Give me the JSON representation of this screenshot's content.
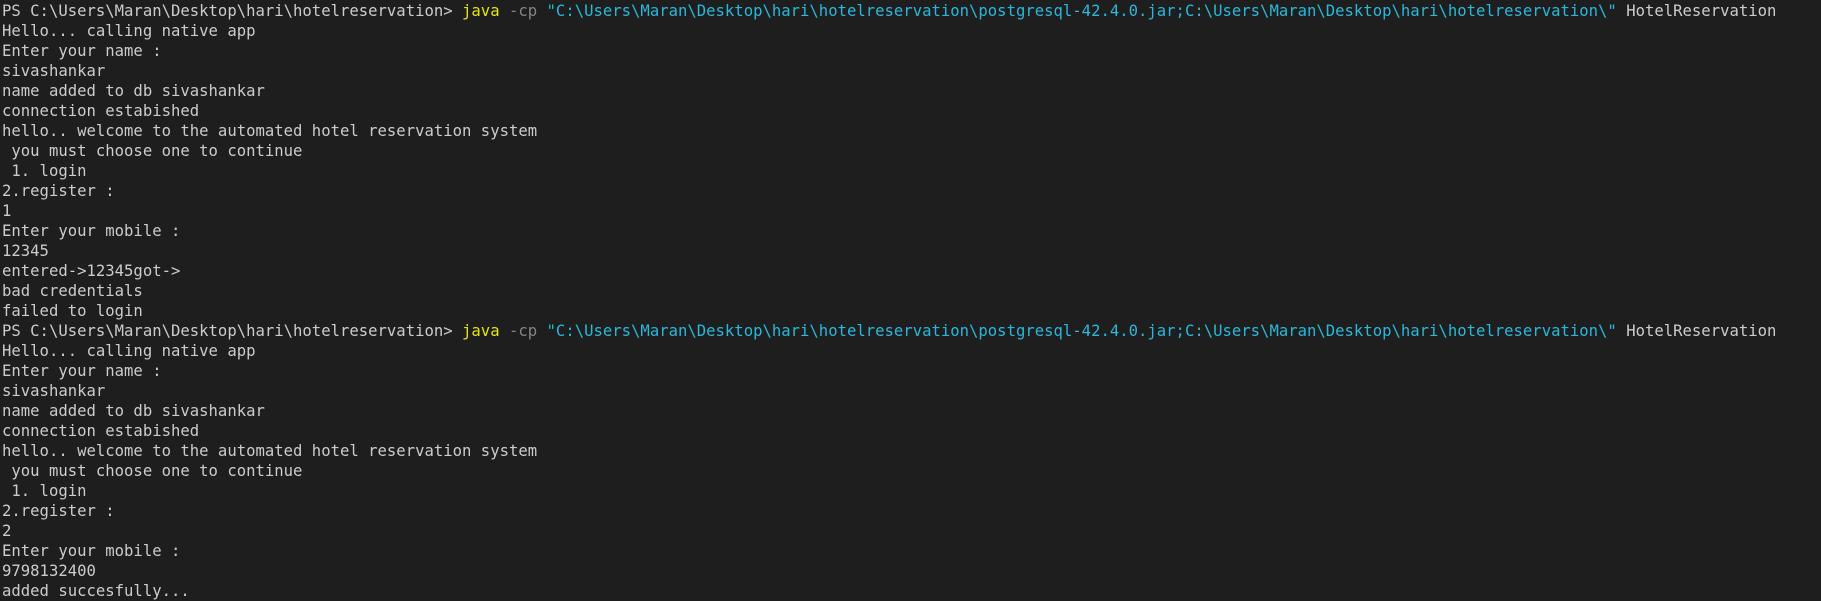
{
  "colors": {
    "background": "#1e1e1e",
    "foreground": "#cccccc",
    "command": "#e5e510",
    "parameter": "#858585",
    "string": "#29b8db"
  },
  "session": [
    {
      "prompt": "PS C:\\Users\\Maran\\Desktop\\hari\\hotelreservation> ",
      "command": "java",
      "param": " -cp ",
      "classpath": "\"C:\\Users\\Maran\\Desktop\\hari\\hotelreservation\\postgresql-42.4.0.jar;C:\\Users\\Maran\\Desktop\\hari\\hotelreservation\\\"",
      "main_class": " HotelReservation",
      "output": [
        "Hello... calling native app",
        "Enter your name :",
        "sivashankar",
        "name added to db sivashankar",
        "connection estabished",
        "hello.. welcome to the automated hotel reservation system",
        " you must choose one to continue",
        " 1. login",
        "2.register :",
        "1",
        "Enter your mobile :",
        "12345",
        "entered->12345got->",
        "bad credentials",
        "failed to login"
      ]
    },
    {
      "prompt": "PS C:\\Users\\Maran\\Desktop\\hari\\hotelreservation> ",
      "command": "java",
      "param": " -cp ",
      "classpath": "\"C:\\Users\\Maran\\Desktop\\hari\\hotelreservation\\postgresql-42.4.0.jar;C:\\Users\\Maran\\Desktop\\hari\\hotelreservation\\\"",
      "main_class": " HotelReservation",
      "output": [
        "Hello... calling native app",
        "Enter your name :",
        "sivashankar",
        "name added to db sivashankar",
        "connection estabished",
        "hello.. welcome to the automated hotel reservation system",
        " you must choose one to continue",
        " 1. login",
        "2.register :",
        "2",
        "Enter your mobile :",
        "9798132400",
        "added succesfully..."
      ]
    }
  ]
}
